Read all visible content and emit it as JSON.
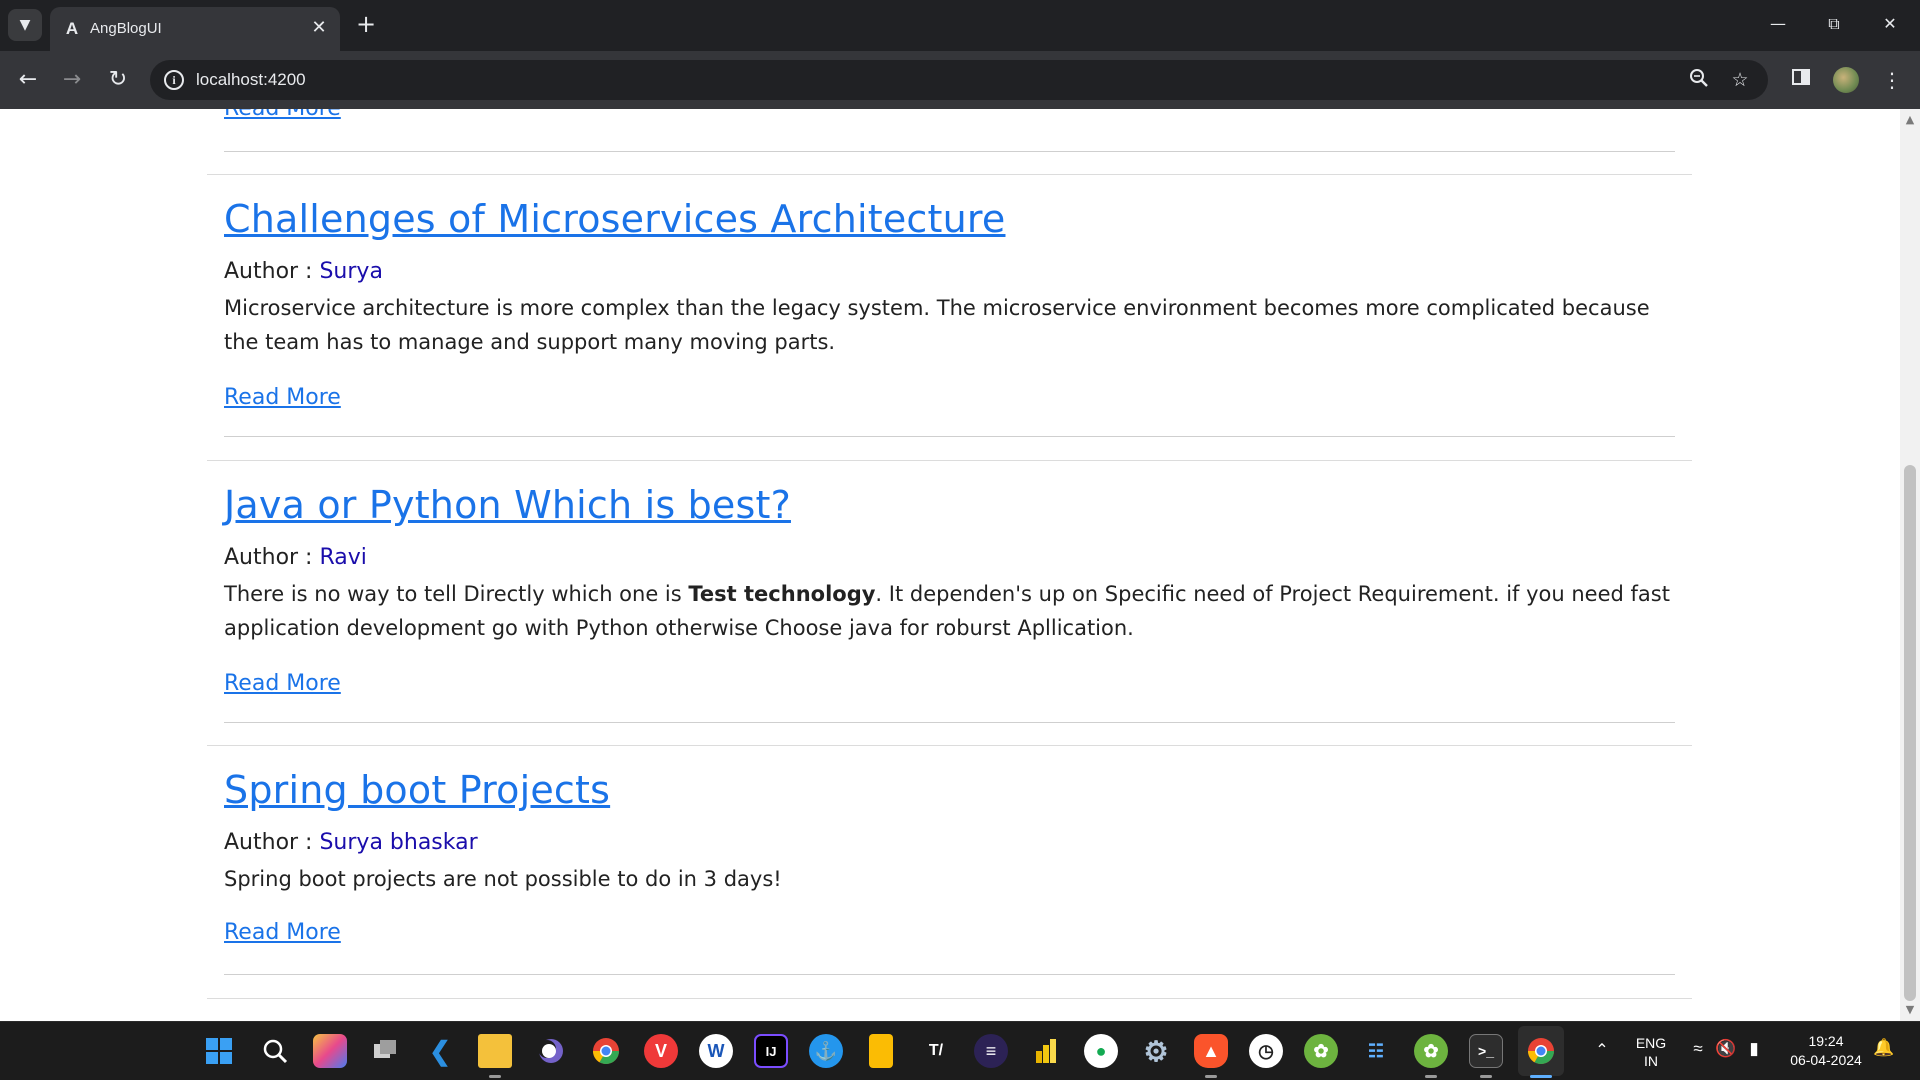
{
  "browser": {
    "tab_title": "AngBlogUI",
    "tab_favicon": "A",
    "tab_close": "✕",
    "new_tab": "+",
    "url": "localhost:4200"
  },
  "page": {
    "partial_post": {
      "read_more": "Read More"
    },
    "posts": [
      {
        "title": "Challenges of Microservices Architecture",
        "author_label": "Author : ",
        "author": "Surya",
        "description": "Microservice architecture is more complex than the legacy system. The microservice environment becomes more complicated because the team has to manage and support many moving parts.",
        "read_more": "Read More"
      },
      {
        "title": "Java or Python Which is best?",
        "author_label": "Author : ",
        "author": "Ravi",
        "description_before": "There is no way to tell Directly which one is ",
        "description_bold": "Test technology",
        "description_after": ". It dependen's up on  Specific need of Project Requirement. if you need fast application development go with Python otherwise Choose java for roburst Apllication.",
        "read_more": "Read More"
      },
      {
        "title": "Spring boot Projects",
        "author_label": "Author : ",
        "author": "Surya bhaskar",
        "description": "Spring boot projects are not possible to do in 3 days!",
        "read_more": "Read More"
      }
    ]
  },
  "taskbar": {
    "language": "ENG",
    "region": "IN",
    "time": "19:24",
    "date": "06-04-2024",
    "apps": [
      "windows-start",
      "search",
      "copilot",
      "task-view",
      "vscode",
      "file-explorer",
      "eclipse",
      "chrome",
      "vivaldi",
      "wordpad",
      "intellij",
      "docker",
      "keep",
      "typora",
      "eclipse-ide",
      "power-bi",
      "mongodb",
      "settings",
      "brave",
      "clock",
      "spring-tool-suite",
      "remote-desktop",
      "spring-boot",
      "terminal",
      "chrome-active"
    ]
  }
}
